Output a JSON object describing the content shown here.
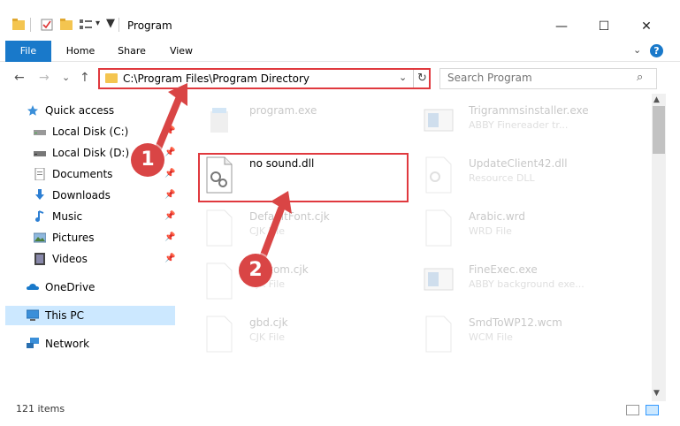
{
  "window": {
    "title": "Program",
    "controls": {
      "minimize": "—",
      "maximize": "☐",
      "close": "✕"
    }
  },
  "ribbon": {
    "tabs": [
      "File",
      "Home",
      "Share",
      "View"
    ],
    "help": "?"
  },
  "nav": {
    "back": "←",
    "forward": "→",
    "recent": "⌄",
    "up": "↑"
  },
  "address": {
    "path": "C:\\Program Files\\Program Directory",
    "dropdown": "⌄",
    "refresh": "↻"
  },
  "search": {
    "placeholder": "Search Program",
    "icon": "⌕"
  },
  "sidebar": {
    "quick_access": "Quick access",
    "items": [
      {
        "label": "Local Disk (C:)",
        "icon": "drive-icon"
      },
      {
        "label": "Local Disk (D:)",
        "icon": "drive-icon"
      },
      {
        "label": "Documents",
        "icon": "documents-icon"
      },
      {
        "label": "Downloads",
        "icon": "downloads-icon"
      },
      {
        "label": "Music",
        "icon": "music-icon"
      },
      {
        "label": "Pictures",
        "icon": "pictures-icon"
      },
      {
        "label": "Videos",
        "icon": "videos-icon"
      }
    ],
    "onedrive": "OneDrive",
    "this_pc": "This PC",
    "network": "Network",
    "pin": "📌"
  },
  "files": [
    {
      "name": "program.exe",
      "desc": ""
    },
    {
      "name": "Trigrammsinstaller.exe",
      "desc": "ABBY Finereader tr..."
    },
    {
      "name": "no sound.dll",
      "desc": ""
    },
    {
      "name": "UpdateClient42.dll",
      "desc": "Resource DLL"
    },
    {
      "name": "DefaultFont.cjk",
      "desc": "CJK File"
    },
    {
      "name": "Arabic.wrd",
      "desc": "WRD File"
    },
    {
      "name": "Custom.cjk",
      "desc": "CJK File"
    },
    {
      "name": "FineExec.exe",
      "desc": "ABBY background exe..."
    },
    {
      "name": "gbd.cjk",
      "desc": "CJK File"
    },
    {
      "name": "SmdToWP12.wcm",
      "desc": "WCM File"
    }
  ],
  "status": {
    "items": "121 items"
  },
  "callouts": {
    "one": "1",
    "two": "2"
  },
  "colors": {
    "accent": "#1979ca",
    "highlight": "#e0393e",
    "callout": "#d94545",
    "selected": "#cce8ff"
  }
}
